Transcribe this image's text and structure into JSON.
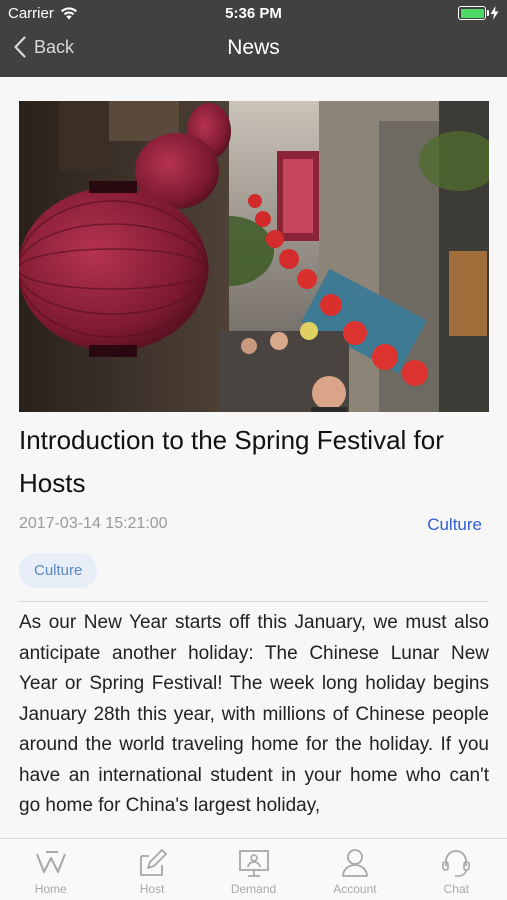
{
  "status_bar": {
    "carrier": "Carrier",
    "time": "5:36 PM",
    "battery_level": 1.0,
    "battery_color": "#4cd964"
  },
  "nav": {
    "back_label": "Back",
    "title": "News",
    "background": "#414141"
  },
  "article": {
    "image_icon": "lantern-street-photo",
    "title": "Introduction to the Spring Festival for Hosts",
    "date": "2017-03-14 15:21:00",
    "category": "Culture",
    "tag": "Culture",
    "body": "As our New Year starts off this January, we must also anticipate another holiday: The Chinese Lunar New Year or Spring Festival! The week long holiday begins January 28th this year, with millions of Chinese people around the world traveling home for the holiday. If you have an international student in your home who can't go home for China's largest holiday,"
  },
  "tabbar": {
    "items": [
      {
        "label": "Home",
        "icon": "home-w-icon"
      },
      {
        "label": "Host",
        "icon": "host-edit-icon"
      },
      {
        "label": "Demand",
        "icon": "demand-screen-icon"
      },
      {
        "label": "Account",
        "icon": "account-person-icon"
      },
      {
        "label": "Chat",
        "icon": "chat-headset-icon"
      }
    ]
  },
  "colors": {
    "accent": "#2f5fd0",
    "tag_bg": "#e8eef7",
    "tag_text": "#5a8ac4"
  }
}
